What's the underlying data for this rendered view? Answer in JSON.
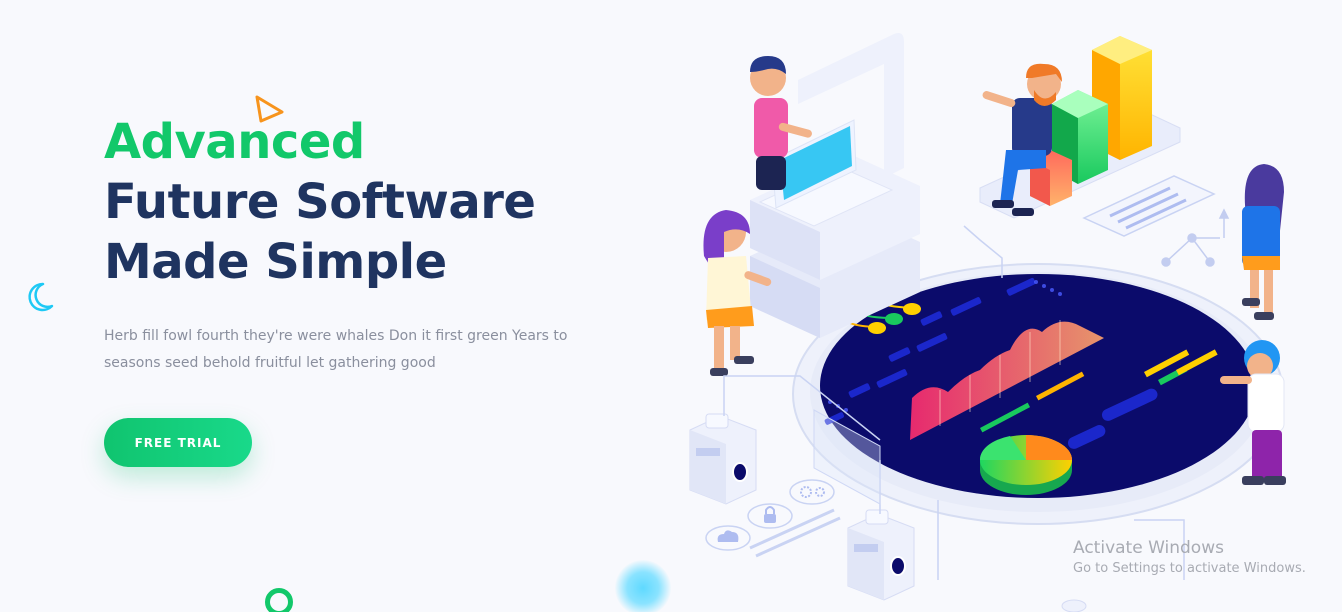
{
  "hero": {
    "headline_accent": "Advanced",
    "headline_line2": "Future Software",
    "headline_line3": "Made Simple",
    "description": "Herb fill fowl fourth they're were whales Don it first green Years to seasons seed behold fruitful let gathering good",
    "cta_label": "FREE TRIAL"
  },
  "colors": {
    "accent_green": "#12c86a",
    "headline_navy": "#1f3460",
    "body_gray": "#8a8f9e",
    "screen_navy": "#0b0b6b"
  },
  "icons": [
    "triangle-icon",
    "moon-icon",
    "ring-icon",
    "settings-icon",
    "lock-icon",
    "cloud-icon"
  ],
  "watermark": {
    "title": "Activate Windows",
    "subtitle": "Go to Settings to activate Windows."
  }
}
